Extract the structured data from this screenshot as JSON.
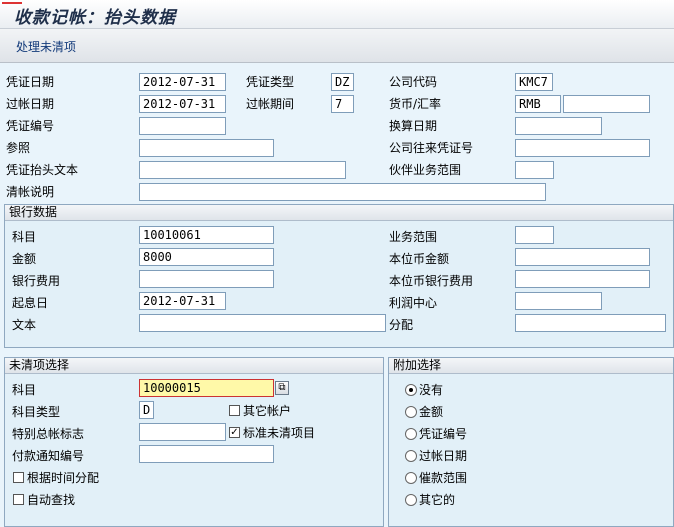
{
  "window": {
    "title": "收款记帐：抬头数据"
  },
  "toolbar": {
    "process_open_items": "处理未清项"
  },
  "header": {
    "doc_date_label": "凭证日期",
    "doc_date": "2012-07-31",
    "doc_type_label": "凭证类型",
    "doc_type": "DZ",
    "company_code_label": "公司代码",
    "company_code": "KMC7",
    "posting_date_label": "过帐日期",
    "posting_date": "2012-07-31",
    "period_label": "过帐期间",
    "period": "7",
    "currency_label": "货币/汇率",
    "currency": "RMB",
    "rate": "",
    "doc_number_label": "凭证编号",
    "doc_number": "",
    "translation_date_label": "换算日期",
    "translation_date": "",
    "reference_label": "参照",
    "reference": "",
    "intercompany_label": "公司往来凭证号",
    "intercompany": "",
    "header_text_label": "凭证抬头文本",
    "header_text": "",
    "partner_ba_label": "伙伴业务范围",
    "partner_ba": "",
    "clearing_text_label": "清帐说明",
    "clearing_text": ""
  },
  "bank": {
    "title": "银行数据",
    "account_label": "科目",
    "account": "10010061",
    "amount_label": "金额",
    "amount": "8000",
    "charges_label": "银行费用",
    "charges": "",
    "value_date_label": "起息日",
    "value_date": "2012-07-31",
    "text_label": "文本",
    "text": "",
    "business_area_label": "业务范围",
    "business_area": "",
    "lc_amount_label": "本位币金额",
    "lc_amount": "",
    "lc_charges_label": "本位币银行费用",
    "lc_charges": "",
    "profit_center_label": "利润中心",
    "profit_center": "",
    "assignment_label": "分配",
    "assignment": ""
  },
  "open_items": {
    "title": "未清项选择",
    "account_label": "科目",
    "account": "10000015",
    "account_type_label": "科目类型",
    "account_type": "D",
    "other_accounts_label": "其它帐户",
    "other_accounts": false,
    "special_gl_label": "特别总帐标志",
    "special_gl": "",
    "standard_oi_label": "标准未清项目",
    "standard_oi": true,
    "payment_advice_label": "付款通知编号",
    "payment_advice": "",
    "distribute_by_age_label": "根据时间分配",
    "distribute_by_age": false,
    "auto_search_label": "自动查找",
    "auto_search": false
  },
  "additional": {
    "title": "附加选择",
    "options": [
      "没有",
      "金额",
      "凭证编号",
      "过帐日期",
      "催款范围",
      "其它的"
    ],
    "selected": 0
  }
}
